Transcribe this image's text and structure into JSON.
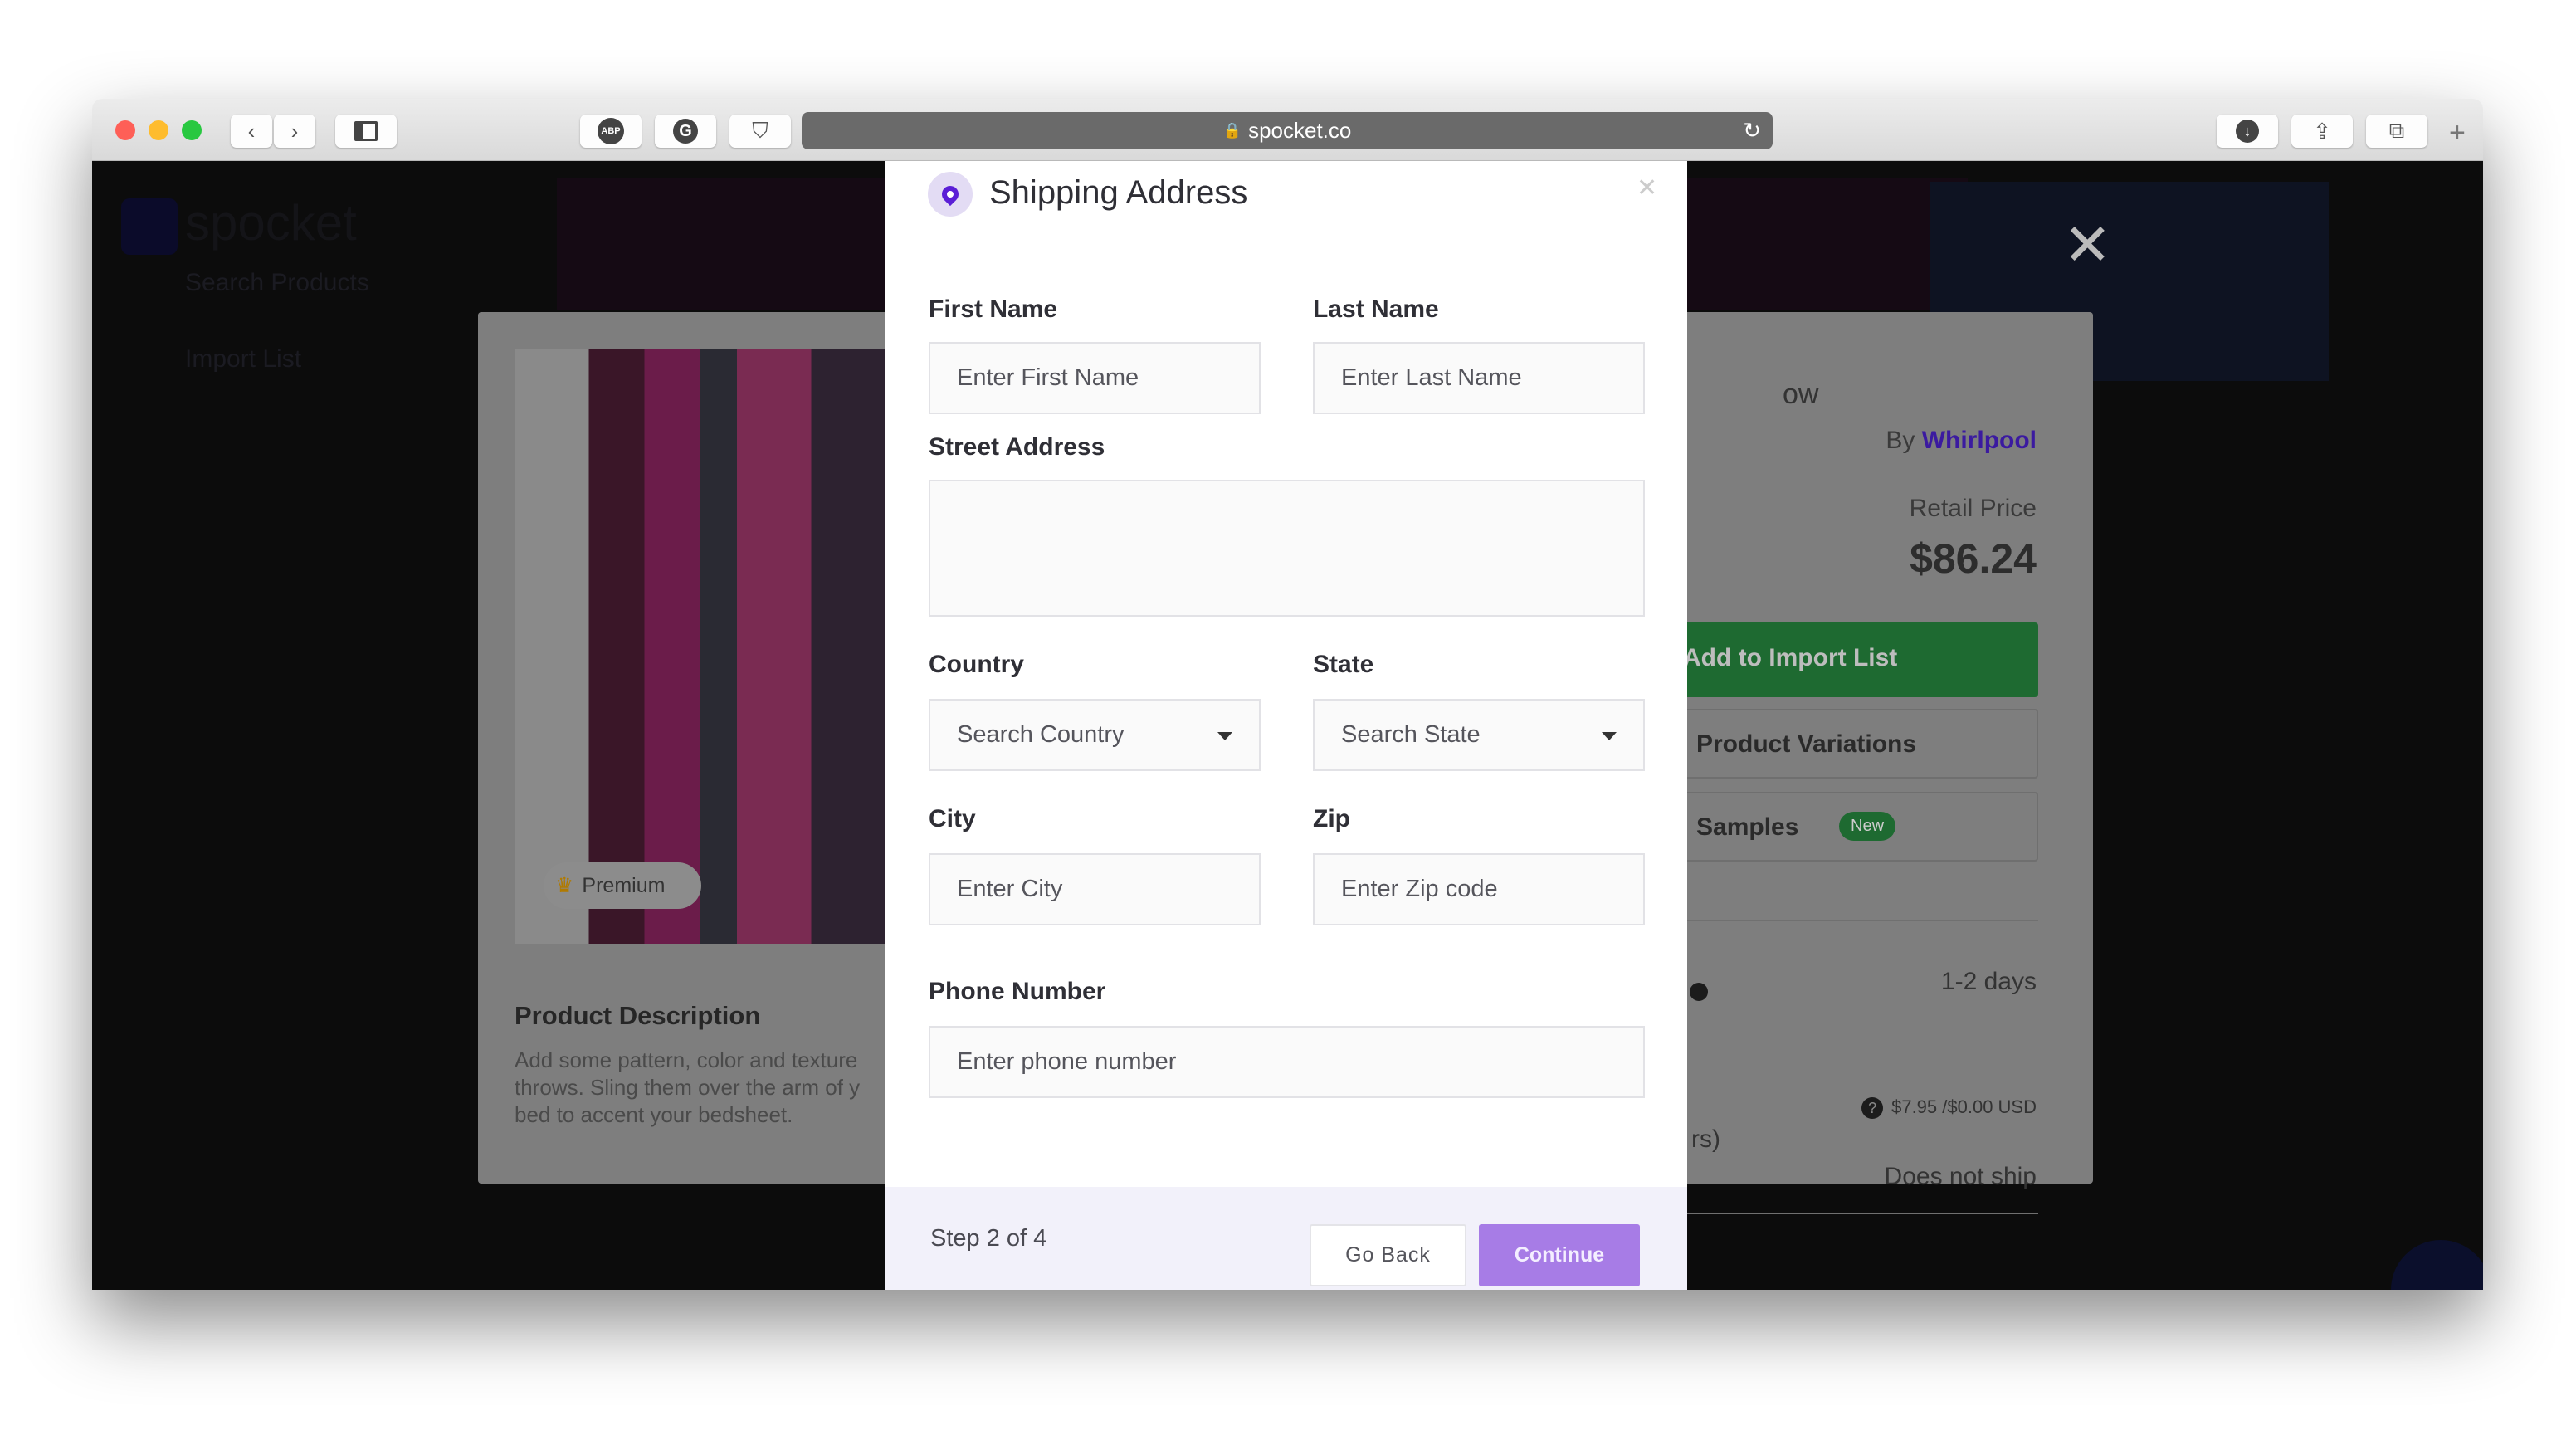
{
  "browser": {
    "url": "spocket.co",
    "extensions": [
      "ABP",
      "G",
      "shield"
    ]
  },
  "background": {
    "logo": "spocket",
    "sidebar": [
      "Search Products",
      "Import List"
    ],
    "product": {
      "title_fragment": "ow",
      "by_label": "By",
      "brand": "Whirlpool",
      "retail_price_label": "Retail Price",
      "retail_price": "$86.24",
      "add_button": "Add to Import List",
      "variations_button": "Product Variations",
      "samples_button": "Samples",
      "new_badge": "New",
      "premium_badge": "Premium",
      "delivery_time": "1-2 days",
      "shipping_cost": "$7.95 /$0.00 USD",
      "shipping_fragment": "rs)",
      "shipping_status": "Does not ship",
      "description_title": "Product Description",
      "description_lines": [
        "Add some pattern, color and texture",
        "throws. Sling them over the arm of y",
        "bed to accent your bedsheet."
      ]
    },
    "colors": {
      "brand_purple": "#5b2fc4",
      "green": "#1e6a31"
    }
  },
  "modal": {
    "title": "Shipping Address",
    "fields": {
      "first_name": {
        "label": "First Name",
        "placeholder": "Enter First Name",
        "value": ""
      },
      "last_name": {
        "label": "Last Name",
        "placeholder": "Enter Last Name",
        "value": ""
      },
      "street": {
        "label": "Street Address",
        "value": ""
      },
      "country": {
        "label": "Country",
        "placeholder": "Search Country"
      },
      "state": {
        "label": "State",
        "placeholder": "Search State"
      },
      "city": {
        "label": "City",
        "placeholder": "Enter City",
        "value": ""
      },
      "zip": {
        "label": "Zip",
        "placeholder": "Enter Zip code",
        "value": ""
      },
      "phone": {
        "label": "Phone Number",
        "placeholder": "Enter phone number",
        "value": ""
      }
    },
    "footer": {
      "step": "Step 2 of 4",
      "back": "Go Back",
      "continue": "Continue"
    },
    "colors": {
      "accent": "#a77ce6",
      "icon": "#5b1fd6"
    }
  }
}
